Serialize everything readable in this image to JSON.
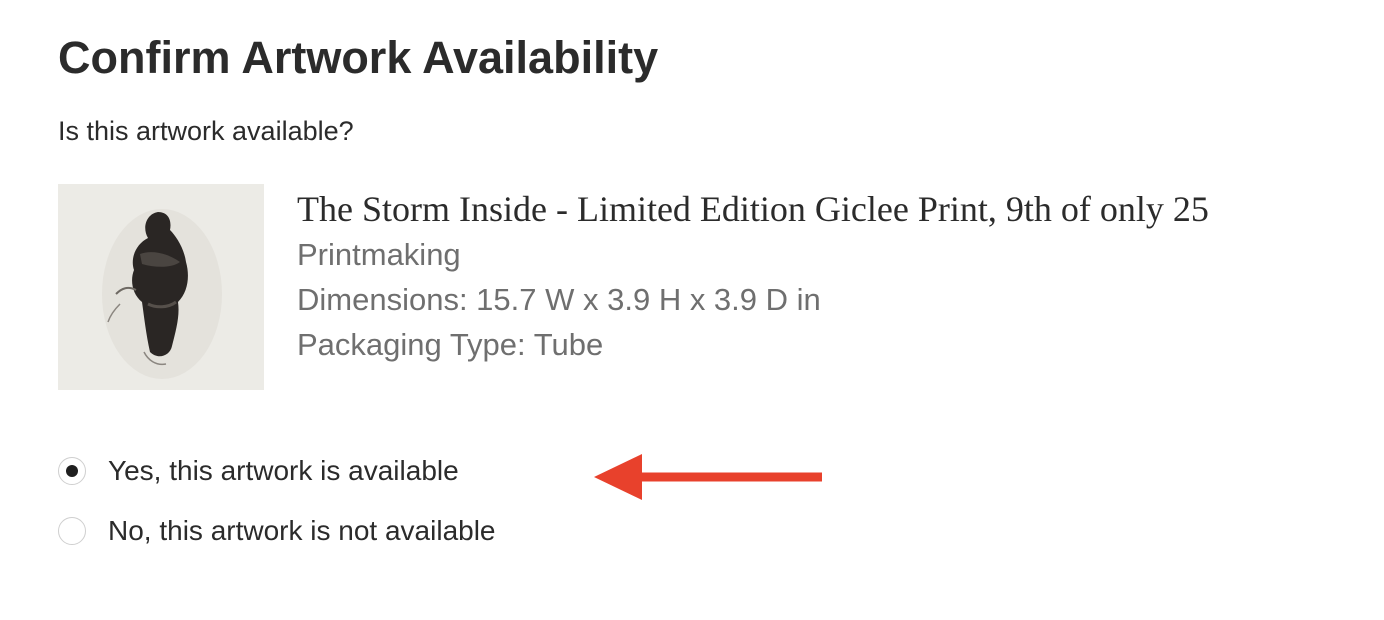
{
  "dialog": {
    "title": "Confirm Artwork Availability",
    "question": "Is this artwork available?"
  },
  "artwork": {
    "title": "The Storm Inside - Limited Edition Giclee Print, 9th of only 25",
    "medium": "Printmaking",
    "dimensions": "Dimensions: 15.7 W x 3.9 H x 3.9 D in",
    "packaging": "Packaging Type: Tube"
  },
  "availability": {
    "options": [
      {
        "label": "Yes, this artwork is available",
        "selected": true
      },
      {
        "label": "No, this artwork is not available",
        "selected": false
      }
    ]
  },
  "annotation": {
    "arrow_icon": "left-arrow-icon",
    "arrow_color": "#e8412c"
  }
}
